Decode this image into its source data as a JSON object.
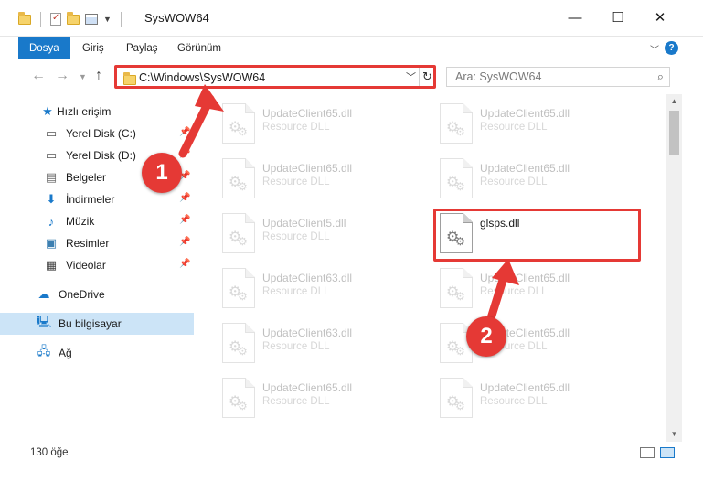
{
  "window": {
    "title": "SysWOW64",
    "minimize_glyph": "—",
    "maximize_glyph": "☐",
    "close_glyph": "✕"
  },
  "ribbon": {
    "tabs": [
      {
        "label": "Dosya",
        "active": true
      },
      {
        "label": "Giriş"
      },
      {
        "label": "Paylaş"
      },
      {
        "label": "Görünüm"
      }
    ],
    "help_glyph": "?"
  },
  "navigation": {
    "address": "C:\\Windows\\SysWOW64",
    "search_placeholder": "Ara: SysWOW64"
  },
  "sidebar": {
    "items": [
      {
        "label": "Hızlı erişim",
        "icon": "star-icon"
      },
      {
        "label": "Yerel Disk (C:)",
        "icon": "drive-icon",
        "pinned": true
      },
      {
        "label": "Yerel Disk (D:)",
        "icon": "drive-icon",
        "pinned": true
      },
      {
        "label": "Belgeler",
        "icon": "documents-icon",
        "pinned": true
      },
      {
        "label": "İndirmeler",
        "icon": "download-icon",
        "pinned": true
      },
      {
        "label": "Müzik",
        "icon": "music-icon",
        "pinned": true
      },
      {
        "label": "Resimler",
        "icon": "pictures-icon",
        "pinned": true
      },
      {
        "label": "Videolar",
        "icon": "videos-icon",
        "pinned": true
      },
      {
        "label": "OneDrive",
        "icon": "cloud-icon"
      },
      {
        "label": "Bu bilgisayar",
        "icon": "computer-icon",
        "selected": true
      },
      {
        "label": "Ağ",
        "icon": "network-icon"
      }
    ]
  },
  "files": [
    {
      "name": "UpdateClient65.dll",
      "type": "Resource DLL",
      "faded": true
    },
    {
      "name": "UpdateClient65.dll",
      "type": "Resource DLL",
      "faded": true
    },
    {
      "name": "UpdateClient65.dll",
      "type": "Resource DLL",
      "faded": true
    },
    {
      "name": "UpdateClient65.dll",
      "type": "Resource DLL",
      "faded": true
    },
    {
      "name": "UpdateClient5.dll",
      "type": "Resource DLL",
      "faded": true
    },
    {
      "name": "glsps.dll",
      "type": "",
      "faded": false,
      "highlighted": true
    },
    {
      "name": "UpdateClient63.dll",
      "type": "Resource DLL",
      "faded": true
    },
    {
      "name": "UpdateClient65.dll",
      "type": "Resource DLL",
      "faded": true
    },
    {
      "name": "UpdateClient63.dll",
      "type": "Resource DLL",
      "faded": true
    },
    {
      "name": "UpdateClient65.dll",
      "type": "Resource DLL",
      "faded": true
    },
    {
      "name": "UpdateClient65.dll",
      "type": "Resource DLL",
      "faded": true
    },
    {
      "name": "UpdateClient65.dll",
      "type": "Resource DLL",
      "faded": true
    }
  ],
  "status": {
    "item_count": "130 öğe"
  },
  "annotations": {
    "step1": "1",
    "step2": "2",
    "color": "#e53935"
  },
  "colors": {
    "accent": "#1979ca",
    "selection": "#cce4f7"
  }
}
